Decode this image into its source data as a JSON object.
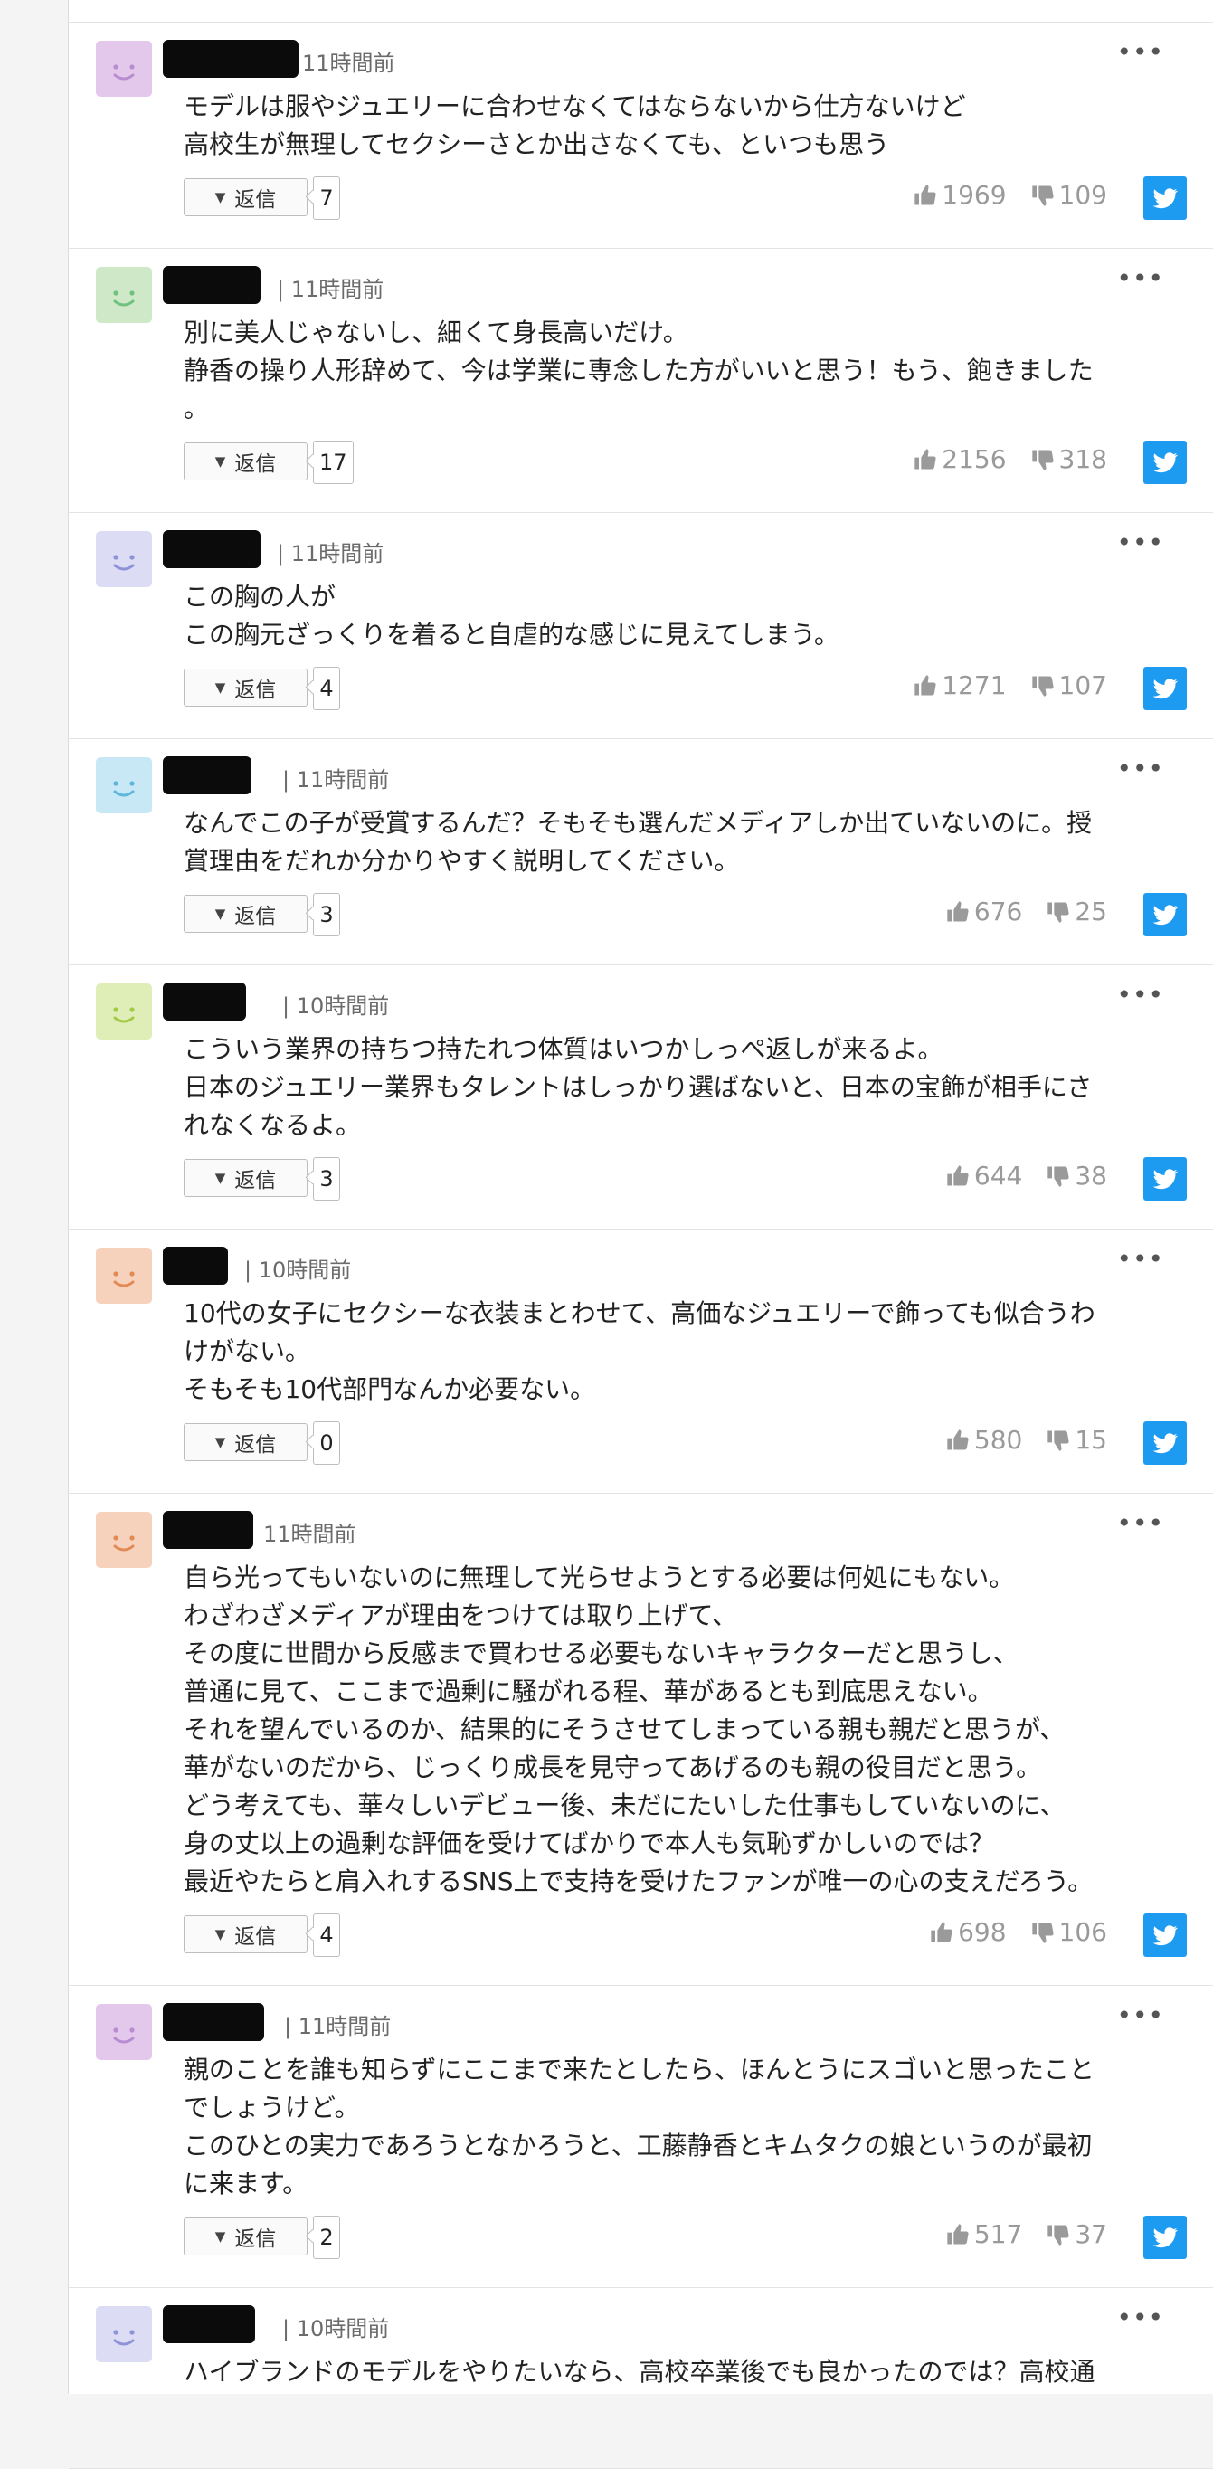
{
  "labels": {
    "reply": "返信",
    "more": "•••"
  },
  "comments": [
    {
      "avatar_color": "#e3c8ec",
      "face_color": "#b88dd0",
      "time": "11時間前",
      "time_sep": false,
      "lines": [
        "モデルは服やジュエリーに合わせなくてはならないから仕方ないけど",
        "高校生が無理してセクシーさとか出さなくても、といつも思う"
      ],
      "replies": "7",
      "likes": "1969",
      "dislikes": "109"
    },
    {
      "avatar_color": "#cfe9c8",
      "face_color": "#6fc17e",
      "time": "11時間前",
      "time_sep": true,
      "lines": [
        "別に美人じゃないし、細くて身長高いだけ。",
        "静香の操り人形辞めて、今は学業に専念した方がいいと思う！もう、飽きました",
        "。"
      ],
      "replies": "17",
      "likes": "2156",
      "dislikes": "318"
    },
    {
      "avatar_color": "#dcdcf4",
      "face_color": "#8e93d8",
      "time": "11時間前",
      "time_sep": true,
      "lines": [
        "この胸の人が",
        "この胸元ざっくりを着ると自虐的な感じに見えてしまう。"
      ],
      "replies": "4",
      "likes": "1271",
      "dislikes": "107"
    },
    {
      "avatar_color": "#c9e8f6",
      "face_color": "#5bb6dc",
      "time": "11時間前",
      "time_sep": true,
      "lines": [
        "なんでこの子が受賞するんだ？そもそも選んだメディアしか出ていないのに。授",
        "賞理由をだれか分かりやすく説明してください。"
      ],
      "replies": "3",
      "likes": "676",
      "dislikes": "25"
    },
    {
      "avatar_color": "#dfeeb6",
      "face_color": "#a3c945",
      "time": "10時間前",
      "time_sep": true,
      "lines": [
        "こういう業界の持ちつ持たれつ体質はいつかしっぺ返しが来るよ。",
        "日本のジュエリー業界もタレントはしっかり選ばないと、日本の宝飾が相手にさ",
        "れなくなるよ。"
      ],
      "replies": "3",
      "likes": "644",
      "dislikes": "38"
    },
    {
      "avatar_color": "#f6d2bd",
      "face_color": "#e28a55",
      "time": "10時間前",
      "time_sep": true,
      "lines": [
        "10代の女子にセクシーな衣装まとわせて、高価なジュエリーで飾っても似合うわ",
        "けがない。",
        "そもそも10代部門なんか必要ない。"
      ],
      "replies": "0",
      "likes": "580",
      "dislikes": "15"
    },
    {
      "avatar_color": "#f6d2bd",
      "face_color": "#e28a55",
      "time": "11時間前",
      "time_sep": false,
      "lines": [
        "自ら光ってもいないのに無理して光らせようとする必要は何処にもない。",
        "わざわざメディアが理由をつけては取り上げて、",
        "その度に世間から反感まで買わせる必要もないキャラクターだと思うし、",
        "普通に見て、ここまで過剰に騒がれる程、華があるとも到底思えない。",
        "それを望んでいるのか、結果的にそうさせてしまっている親も親だと思うが、",
        "華がないのだから、じっくり成長を見守ってあげるのも親の役目だと思う。",
        "どう考えても、華々しいデビュー後、未だにたいした仕事もしていないのに、",
        "身の丈以上の過剰な評価を受けてばかりで本人も気恥ずかしいのでは？",
        "最近やたらと肩入れするSNS上で支持を受けたファンが唯一の心の支えだろう。"
      ],
      "replies": "4",
      "likes": "698",
      "dislikes": "106"
    },
    {
      "avatar_color": "#e3c8ec",
      "face_color": "#b88dd0",
      "time": "11時間前",
      "time_sep": true,
      "lines": [
        "親のことを誰も知らずにここまで来たとしたら、ほんとうにスゴいと思ったこと",
        "でしょうけど。",
        "このひとの実力であろうとなかろうと、工藤静香とキムタクの娘というのが最初",
        "に来ます。"
      ],
      "replies": "2",
      "likes": "517",
      "dislikes": "37"
    },
    {
      "avatar_color": "#dcdcf4",
      "face_color": "#8e93d8",
      "time": "10時間前",
      "time_sep": true,
      "lines": [
        "ハイブランドのモデルをやりたいなら、高校卒業後でも良かったのでは？高校通"
      ],
      "replies": null,
      "likes": null,
      "dislikes": null
    }
  ]
}
